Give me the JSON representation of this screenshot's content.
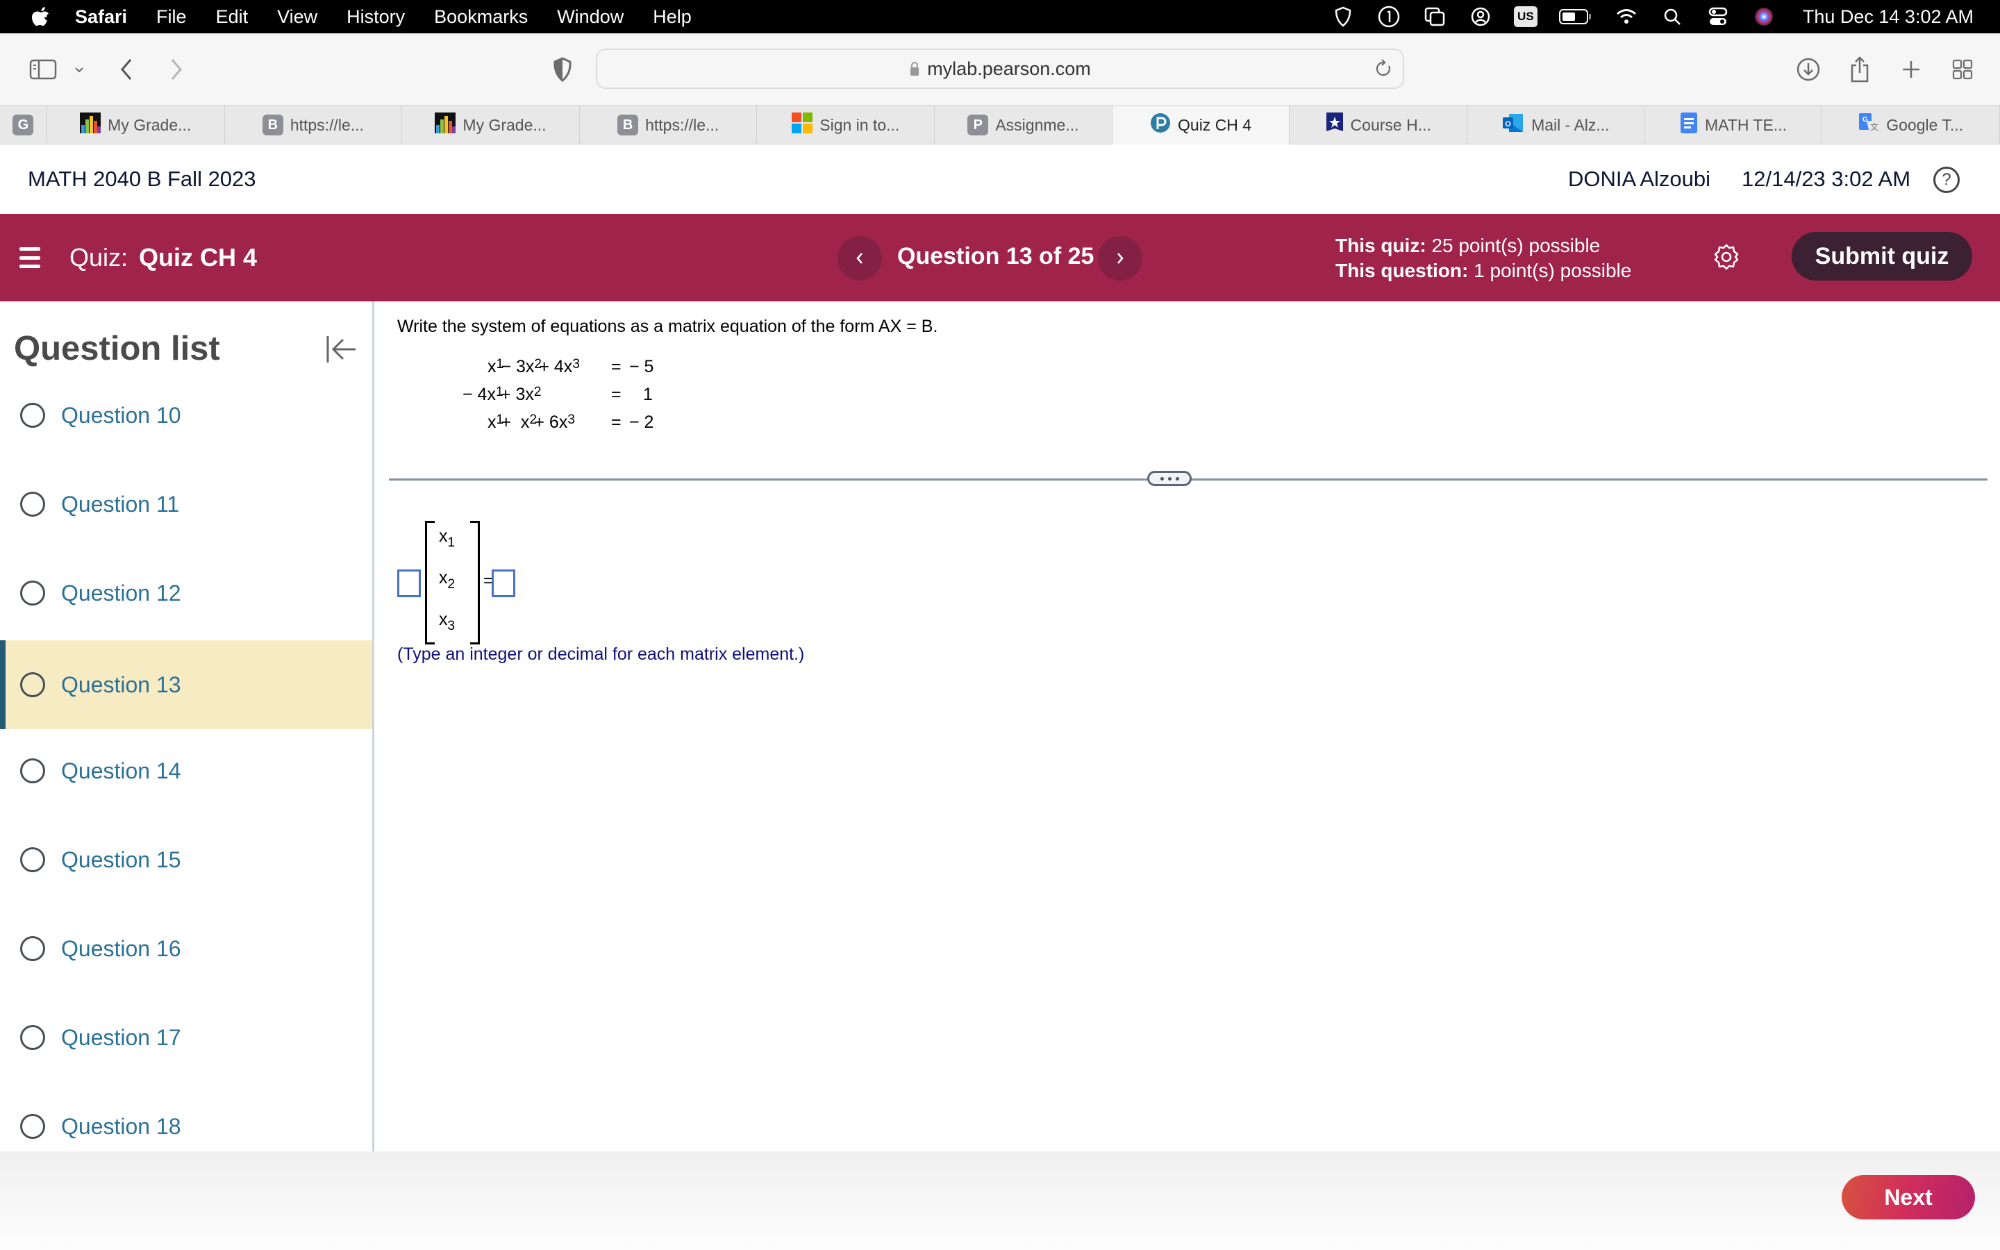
{
  "menubar": {
    "app": "Safari",
    "items": [
      "File",
      "Edit",
      "View",
      "History",
      "Bookmarks",
      "Window",
      "Help"
    ],
    "status_icons": [
      "shield-icon",
      "one-password-icon",
      "window-stack-icon",
      "user-circle-icon",
      "input-source-us",
      "battery-icon",
      "wifi-icon",
      "spotlight-search-icon",
      "control-center-icon",
      "siri-icon"
    ],
    "input_source": "US",
    "clock": "Thu Dec 14  3:02 AM"
  },
  "toolbar": {
    "url": "mylab.pearson.com"
  },
  "tabs": [
    {
      "label": "",
      "favicon": "G",
      "pinned": true
    },
    {
      "label": "My Grade...",
      "favicon": "bars"
    },
    {
      "label": "https://le...",
      "favicon": "B"
    },
    {
      "label": "My Grade...",
      "favicon": "bars"
    },
    {
      "label": "https://le...",
      "favicon": "B"
    },
    {
      "label": "Sign in to...",
      "favicon": "microsoft"
    },
    {
      "label": "Assignme...",
      "favicon": "P"
    },
    {
      "label": "Quiz CH 4",
      "favicon": "pearson",
      "active": true
    },
    {
      "label": "Course H...",
      "favicon": "star-shield"
    },
    {
      "label": "Mail - Alz...",
      "favicon": "outlook"
    },
    {
      "label": "MATH TE...",
      "favicon": "docs"
    },
    {
      "label": "Google T...",
      "favicon": "translate"
    }
  ],
  "course": {
    "title": "MATH 2040 B Fall 2023",
    "user": "DONIA Alzoubi",
    "datetime": "12/14/23 3:02 AM"
  },
  "quizbar": {
    "quiz_label": "Quiz:",
    "quiz_name": "Quiz CH 4",
    "question_counter": "Question 13 of 25",
    "quiz_points_label": "This quiz:",
    "quiz_points_value": "25 point(s) possible",
    "question_points_label": "This question:",
    "question_points_value": "1 point(s) possible",
    "submit_label": "Submit quiz",
    "colors": {
      "bar": "#a0234b",
      "submit": "#3b2131"
    }
  },
  "sidebar": {
    "title": "Question list",
    "current": "Question 13",
    "items": [
      {
        "label": "Question 10"
      },
      {
        "label": "Question 11"
      },
      {
        "label": "Question 12"
      },
      {
        "label": "Question 13"
      },
      {
        "label": "Question 14"
      },
      {
        "label": "Question 15"
      },
      {
        "label": "Question 16"
      },
      {
        "label": "Question 17"
      },
      {
        "label": "Question 18"
      }
    ]
  },
  "question": {
    "prompt": "Write the system of equations as a matrix equation of the form AX = B.",
    "equations": [
      {
        "lhs_parts": [
          "x",
          "1",
          " − 3x",
          "2",
          " + 4x",
          "3"
        ],
        "eq": "=",
        "rhs": "− 5"
      },
      {
        "lhs_parts": [
          "− 4x",
          "1",
          " + 3x",
          "2",
          "",
          ""
        ],
        "eq": "=",
        "rhs": "1"
      },
      {
        "lhs_parts": [
          "x",
          "1",
          " +  x",
          "2",
          " + 6x",
          "3"
        ],
        "eq": "=",
        "rhs": "− 2"
      }
    ],
    "variables": [
      {
        "base": "x",
        "sub": "1"
      },
      {
        "base": "x",
        "sub": "2"
      },
      {
        "base": "x",
        "sub": "3"
      }
    ],
    "equals": "=",
    "answer_A": "",
    "answer_B": "",
    "hint": "(Type an integer or decimal for each matrix element.)"
  },
  "footer": {
    "next_label": "Next"
  }
}
